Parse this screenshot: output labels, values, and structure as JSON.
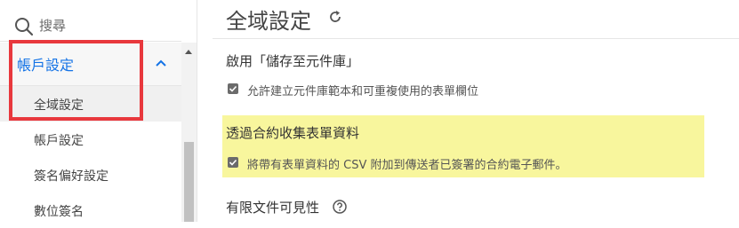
{
  "sidebar": {
    "search_placeholder": "搜尋",
    "group_label": "帳戶設定",
    "items": [
      {
        "label": "全域設定",
        "active": true
      },
      {
        "label": "帳戶設定",
        "active": false
      },
      {
        "label": "簽名偏好設定",
        "active": false
      },
      {
        "label": "數位簽名",
        "active": false
      }
    ]
  },
  "main": {
    "title": "全域設定",
    "sections": [
      {
        "title": "啟用「儲存至元件庫」",
        "option": "允許建立元件庫範本和可重複使用的表單欄位",
        "checked": true
      },
      {
        "title": "透過合約收集表單資料",
        "option": "將帶有表單資料的 CSV 附加到傳送者已簽署的合約電子郵件。",
        "checked": true,
        "highlighted": true
      },
      {
        "title": "有限文件可見性"
      }
    ]
  },
  "colors": {
    "accent": "#1473e6",
    "highlight_border": "#e8383d",
    "yellow_highlight": "#f8f69d"
  }
}
